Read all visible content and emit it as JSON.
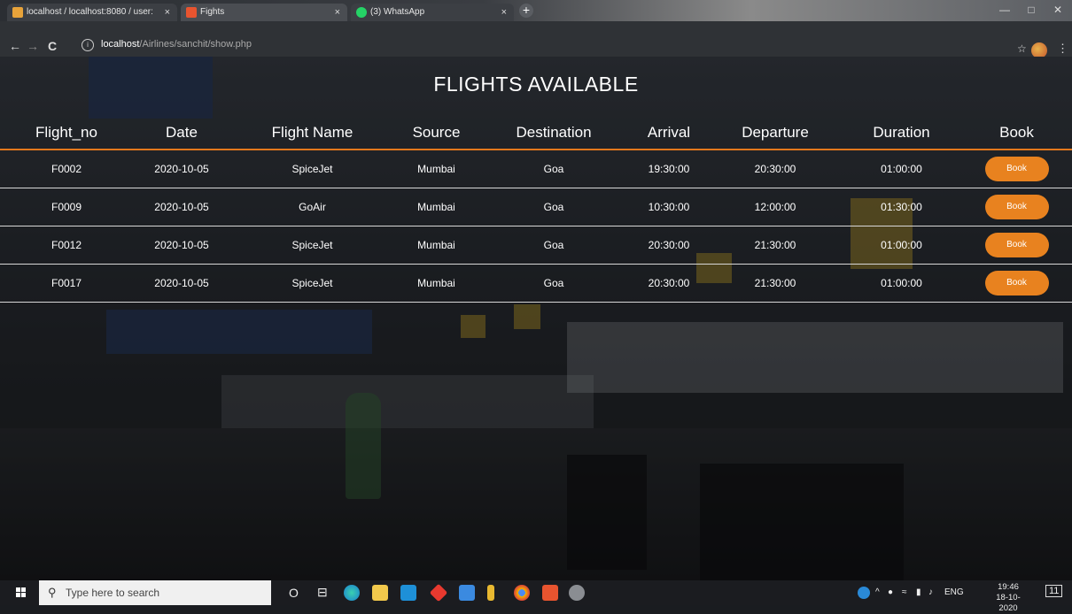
{
  "browser": {
    "tabs": [
      {
        "title": "localhost / localhost:8080 / user:",
        "close": "×",
        "fav_color": "#e8a33a"
      },
      {
        "title": "Fights",
        "close": "×",
        "fav_color": "#e8542f"
      },
      {
        "title": "(3) WhatsApp",
        "close": "×",
        "fav_color": "#25d366"
      }
    ],
    "new_tab": "+",
    "back": "←",
    "forward": "→",
    "reload": "C",
    "info": "i",
    "url_host": "localhost",
    "url_path": "/Airlines/sanchit/show.php",
    "star": "☆",
    "kebab": "⋮",
    "window_controls": [
      "—",
      "□",
      "✕"
    ]
  },
  "page": {
    "title": "FLIGHTS AVAILABLE",
    "columns": [
      "Flight_no",
      "Date",
      "Flight Name",
      "Source",
      "Destination",
      "Arrival",
      "Departure",
      "Duration",
      "Book"
    ],
    "rows": [
      [
        "F0002",
        "2020-10-05",
        "SpiceJet",
        "Mumbai",
        "Goa",
        "19:30:00",
        "20:30:00",
        "01:00:00",
        "Book"
      ],
      [
        "F0009",
        "2020-10-05",
        "GoAir",
        "Mumbai",
        "Goa",
        "10:30:00",
        "12:00:00",
        "01:30:00",
        "Book"
      ],
      [
        "F0012",
        "2020-10-05",
        "SpiceJet",
        "Mumbai",
        "Goa",
        "20:30:00",
        "21:30:00",
        "01:00:00",
        "Book"
      ],
      [
        "F0017",
        "2020-10-05",
        "SpiceJet",
        "Mumbai",
        "Goa",
        "20:30:00",
        "21:30:00",
        "01:00:00",
        "Book"
      ]
    ],
    "accent_color": "#e8821f"
  },
  "taskbar": {
    "search_placeholder": "Type here to search",
    "search_glyph": "⚲",
    "cortana": "O",
    "taskview": "⊟",
    "tray_lang": "ENG",
    "tray_arrow": "^",
    "time": "19:46",
    "date": "18-10-2020",
    "notification": "11"
  }
}
